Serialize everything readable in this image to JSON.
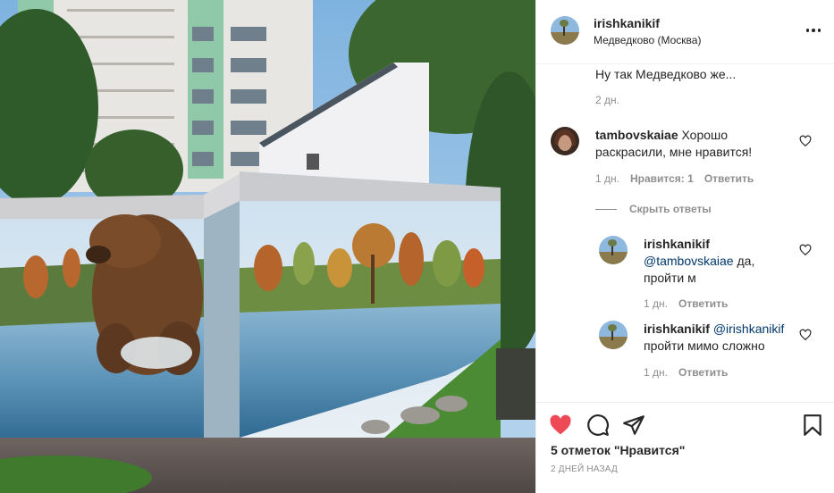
{
  "post": {
    "username": "irishkanikif",
    "location": "Медведково (Москва)"
  },
  "comments": [
    {
      "id": "c0",
      "text": "Ну так Медведково же...",
      "time": "2 дн."
    },
    {
      "id": "c1",
      "username": "tambovskaiae",
      "text": "Хорошо раскрасили, мне нравится!",
      "time": "1 дн.",
      "likes": "Нравится: 1",
      "reply": "Ответить"
    }
  ],
  "hide_replies": "Скрыть ответы",
  "replies": [
    {
      "username": "irishkanikif",
      "mention": "@tambovskaiae",
      "text_after": " да, пройти м",
      "time": "1 дн.",
      "reply": "Ответить"
    },
    {
      "username": "irishkanikif",
      "mention": "@irishkanikif",
      "text_after": " пройти мимо сложно",
      "time": "1 дн.",
      "reply": "Ответить"
    }
  ],
  "actions": {
    "likes_count": "5 отметок \"Нравится\"",
    "posted_ago": "2 ДНЕЙ НАЗАД"
  },
  "icons": {
    "like": "heart-filled-icon",
    "comment": "speech-bubble-icon",
    "share": "paper-plane-icon",
    "save": "bookmark-icon",
    "more": "more-horizontal-icon"
  },
  "colors": {
    "like_red": "#ed4956",
    "text": "#262626",
    "secondary": "#8e8e8e",
    "link": "#00376b"
  }
}
